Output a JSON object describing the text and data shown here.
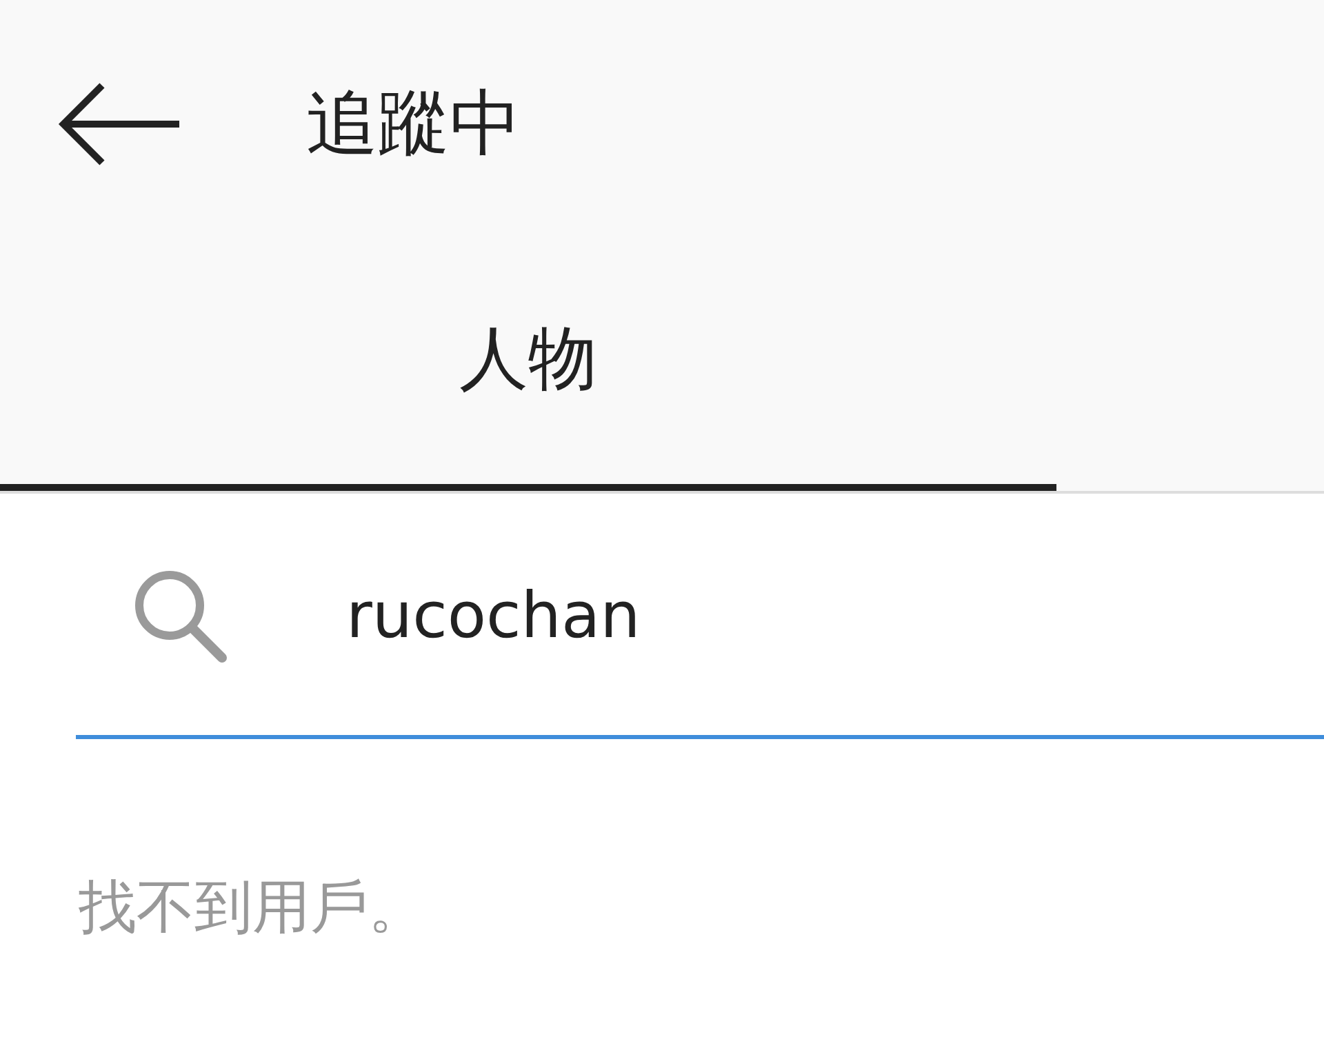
{
  "header": {
    "title": "追蹤中"
  },
  "tabs": [
    {
      "label": "人物",
      "selected": true
    }
  ],
  "search": {
    "value": "rucochan",
    "focused": true
  },
  "message": "找不到用戶。"
}
